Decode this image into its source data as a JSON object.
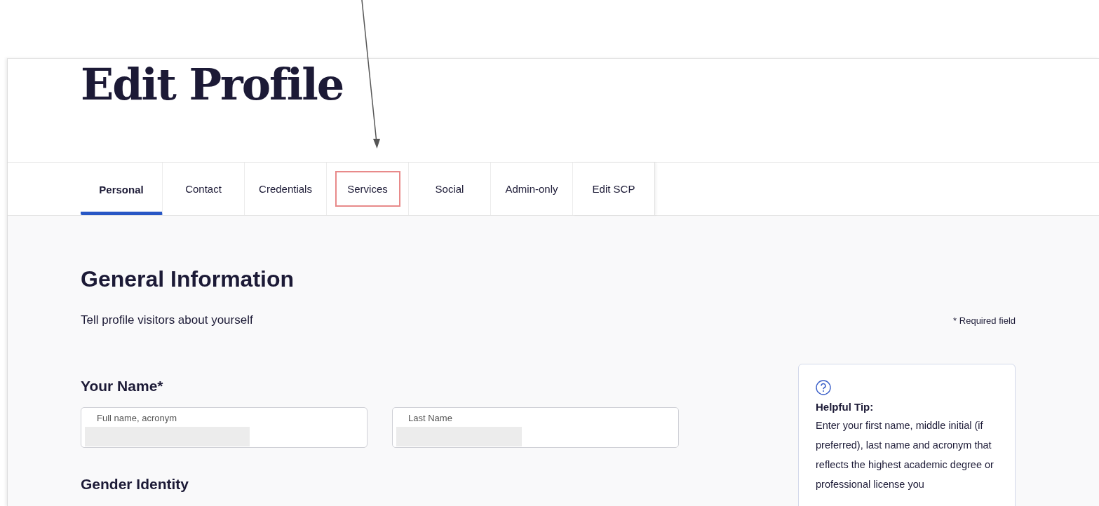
{
  "page": {
    "title": "Edit Profile"
  },
  "annotation": {
    "kind": "arrow"
  },
  "tabs": [
    {
      "label": "Personal",
      "selected": true,
      "highlighted": false
    },
    {
      "label": "Contact",
      "selected": false,
      "highlighted": false
    },
    {
      "label": "Credentials",
      "selected": false,
      "highlighted": false
    },
    {
      "label": "Services",
      "selected": false,
      "highlighted": true
    },
    {
      "label": "Social",
      "selected": false,
      "highlighted": false
    },
    {
      "label": "Admin-only",
      "selected": false,
      "highlighted": false
    },
    {
      "label": "Edit SCP",
      "selected": false,
      "highlighted": false
    }
  ],
  "section": {
    "title": "General Information",
    "subtitle": "Tell profile visitors about yourself",
    "required_note": "* Required field"
  },
  "name_group": {
    "title": "Your Name*",
    "fields": [
      {
        "label": "Full name, acronym",
        "redacted": true
      },
      {
        "label": "Last Name",
        "redacted": true
      }
    ]
  },
  "gender_group": {
    "title": "Gender Identity"
  },
  "tip": {
    "title": "Helpful Tip:",
    "body": "Enter your first name, middle initial (if preferred), last name and acronym that reflects the highest academic degree or professional license you"
  }
}
